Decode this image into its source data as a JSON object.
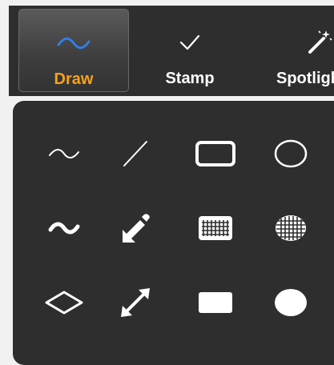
{
  "toolbar": {
    "tools": [
      {
        "label": "Draw",
        "icon": "wave-line-icon",
        "active": true
      },
      {
        "label": "Stamp",
        "icon": "checkmark-icon",
        "active": false
      },
      {
        "label": "Spotlight",
        "icon": "magic-wand-icon",
        "active": false
      }
    ]
  },
  "draw_panel": {
    "rows": [
      [
        "thin-wave-icon",
        "thin-line-icon",
        "outlined-rectangle-icon",
        "outlined-ellipse-icon"
      ],
      [
        "thick-wave-icon",
        "thick-arrow-icon",
        "grid-rectangle-icon",
        "grid-ellipse-icon"
      ],
      [
        "diamond-icon",
        "double-arrow-icon",
        "filled-rectangle-icon",
        "filled-ellipse-icon"
      ]
    ]
  },
  "colors": {
    "background": "#2e2e2e",
    "active_label": "#f7a21b",
    "draw_icon": "#2f7fe6",
    "icon": "#ffffff"
  }
}
